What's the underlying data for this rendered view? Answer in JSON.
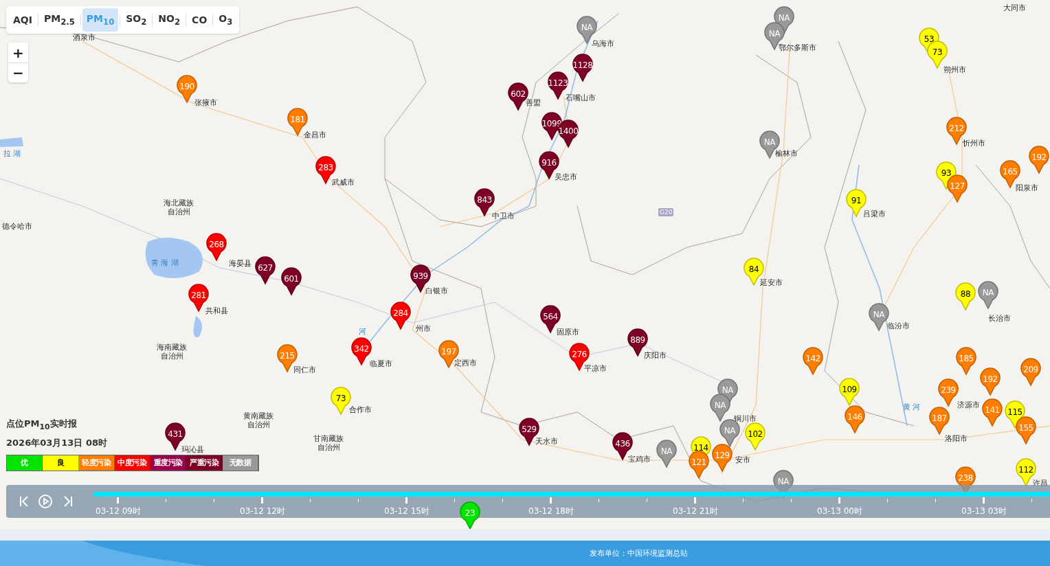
{
  "tabs": [
    {
      "label": "AQI",
      "selected": false
    },
    {
      "label": "PM$_{2.5}$",
      "selected": false
    },
    {
      "label": "PM$_{10}$",
      "selected": true
    },
    {
      "label": "SO$_{2}$",
      "selected": false
    },
    {
      "label": "NO$_{2}$",
      "selected": false
    },
    {
      "label": "CO",
      "selected": false
    },
    {
      "label": "O$_{3}$",
      "selected": false
    }
  ],
  "zoom": {
    "in": "+",
    "out": "−"
  },
  "cities": [
    {
      "name": "大同市",
      "kind": "city"
    },
    {
      "name": "酒泉市",
      "kind": "city"
    },
    {
      "name": "乌海市",
      "kind": "city"
    },
    {
      "name": "鄂尔多斯市",
      "kind": "city"
    },
    {
      "name": "朔州市",
      "kind": "city"
    },
    {
      "name": "张掖市",
      "kind": "city"
    },
    {
      "name": "善盟",
      "kind": "city"
    },
    {
      "name": "石嘴山市",
      "kind": "city"
    },
    {
      "name": "金昌市",
      "kind": "city"
    },
    {
      "name": "忻州市",
      "kind": "city"
    },
    {
      "name": "榆林市",
      "kind": "city"
    },
    {
      "name": "武威市",
      "kind": "city"
    },
    {
      "name": "吴忠市",
      "kind": "city"
    },
    {
      "name": "阳泉市",
      "kind": "city"
    },
    {
      "name": "海北藏族自治州",
      "kind": "prefecture"
    },
    {
      "name": "中卫市",
      "kind": "city"
    },
    {
      "name": "吕梁市",
      "kind": "city"
    },
    {
      "name": "德令哈市",
      "kind": "city"
    },
    {
      "name": "海晏县",
      "kind": "city"
    },
    {
      "name": "延安市",
      "kind": "city"
    },
    {
      "name": "白银市",
      "kind": "city"
    },
    {
      "name": "共和县",
      "kind": "city"
    },
    {
      "name": "州市",
      "kind": "city"
    },
    {
      "name": "固原市",
      "kind": "city"
    },
    {
      "name": "临汾市",
      "kind": "city"
    },
    {
      "name": "长治市",
      "kind": "city"
    },
    {
      "name": "海南藏族自治州",
      "kind": "prefecture"
    },
    {
      "name": "同仁市",
      "kind": "city"
    },
    {
      "name": "临夏市",
      "kind": "city"
    },
    {
      "name": "定西市",
      "kind": "city"
    },
    {
      "name": "平凉市",
      "kind": "city"
    },
    {
      "name": "庆阳市",
      "kind": "city"
    },
    {
      "name": "黄南藏族自治州",
      "kind": "prefecture"
    },
    {
      "name": "合作市",
      "kind": "city"
    },
    {
      "name": "铜川市",
      "kind": "city"
    },
    {
      "name": "济源市",
      "kind": "city"
    },
    {
      "name": "玛沁县",
      "kind": "city"
    },
    {
      "name": "甘南藏族自治州",
      "kind": "prefecture"
    },
    {
      "name": "天水市",
      "kind": "city"
    },
    {
      "name": "宝鸡市",
      "kind": "city"
    },
    {
      "name": "安市",
      "kind": "city"
    },
    {
      "name": "洛阳市",
      "kind": "city"
    },
    {
      "name": "许昌",
      "kind": "city"
    }
  ],
  "water_labels": [
    "拉 湖",
    "青 海 湖",
    "河",
    "黄 河"
  ],
  "road_badge": "G20",
  "markers": [
    {
      "value": "NA",
      "color": "#999999"
    },
    {
      "value": "NA",
      "color": "#999999"
    },
    {
      "value": "NA",
      "color": "#999999"
    },
    {
      "value": "53",
      "color": "#ffff00"
    },
    {
      "value": "73",
      "color": "#ffff00"
    },
    {
      "value": "1128",
      "color": "#7e0023"
    },
    {
      "value": "1123",
      "color": "#7e0023"
    },
    {
      "value": "190",
      "color": "#ff7e00"
    },
    {
      "value": "602",
      "color": "#7e0023"
    },
    {
      "value": "181",
      "color": "#ff7e00"
    },
    {
      "value": "1099",
      "color": "#7e0023"
    },
    {
      "value": "1400",
      "color": "#7e0023"
    },
    {
      "value": "212",
      "color": "#ff7e00"
    },
    {
      "value": "NA",
      "color": "#999999"
    },
    {
      "value": "192",
      "color": "#ff7e00"
    },
    {
      "value": "916",
      "color": "#7e0023"
    },
    {
      "value": "283",
      "color": "#ff0000"
    },
    {
      "value": "93",
      "color": "#ffff00"
    },
    {
      "value": "165",
      "color": "#ff7e00"
    },
    {
      "value": "127",
      "color": "#ff7e00"
    },
    {
      "value": "843",
      "color": "#7e0023"
    },
    {
      "value": "91",
      "color": "#ffff00"
    },
    {
      "value": "268",
      "color": "#ff0000"
    },
    {
      "value": "627",
      "color": "#7e0023"
    },
    {
      "value": "84",
      "color": "#ffff00"
    },
    {
      "value": "601",
      "color": "#7e0023"
    },
    {
      "value": "939",
      "color": "#7e0023"
    },
    {
      "value": "281",
      "color": "#ff0000"
    },
    {
      "value": "88",
      "color": "#ffff00"
    },
    {
      "value": "NA",
      "color": "#999999"
    },
    {
      "value": "284",
      "color": "#ff0000"
    },
    {
      "value": "564",
      "color": "#7e0023"
    },
    {
      "value": "NA",
      "color": "#999999"
    },
    {
      "value": "889",
      "color": "#7e0023"
    },
    {
      "value": "342",
      "color": "#ff0000"
    },
    {
      "value": "197",
      "color": "#ff7e00"
    },
    {
      "value": "215",
      "color": "#ff7e00"
    },
    {
      "value": "276",
      "color": "#ff0000"
    },
    {
      "value": "142",
      "color": "#ff7e00"
    },
    {
      "value": "185",
      "color": "#ff7e00"
    },
    {
      "value": "209",
      "color": "#ff7e00"
    },
    {
      "value": "192",
      "color": "#ff7e00"
    },
    {
      "value": "NA",
      "color": "#999999"
    },
    {
      "value": "109",
      "color": "#ffff00"
    },
    {
      "value": "239",
      "color": "#ff7e00"
    },
    {
      "value": "73",
      "color": "#ffff00"
    },
    {
      "value": "NA",
      "color": "#999999"
    },
    {
      "value": "141",
      "color": "#ff7e00"
    },
    {
      "value": "115",
      "color": "#ffff00"
    },
    {
      "value": "146",
      "color": "#ff7e00"
    },
    {
      "value": "187",
      "color": "#ff7e00"
    },
    {
      "value": "155",
      "color": "#ff7e00"
    },
    {
      "value": "431",
      "color": "#7e0023"
    },
    {
      "value": "529",
      "color": "#7e0023"
    },
    {
      "value": "NA",
      "color": "#999999"
    },
    {
      "value": "102",
      "color": "#ffff00"
    },
    {
      "value": "436",
      "color": "#7e0023"
    },
    {
      "value": "NA",
      "color": "#999999"
    },
    {
      "value": "114",
      "color": "#ffff00"
    },
    {
      "value": "129",
      "color": "#ff7e00"
    },
    {
      "value": "121",
      "color": "#ff7e00"
    },
    {
      "value": "112",
      "color": "#ffff00"
    },
    {
      "value": "238",
      "color": "#ff7e00"
    },
    {
      "value": "NA",
      "color": "#999999"
    },
    {
      "value": "23",
      "color": "#00e400"
    }
  ],
  "report_title": "点位PM$_{10}$实时报",
  "report_time": "2026年03月13日 08时",
  "legend": [
    {
      "label": "优",
      "color": "#00e400"
    },
    {
      "label": "良",
      "color": "#ffff00"
    },
    {
      "label": "轻度污染",
      "color": "#ff7e00"
    },
    {
      "label": "中度污染",
      "color": "#ff0000"
    },
    {
      "label": "重度污染",
      "color": "#99004c"
    },
    {
      "label": "严重污染",
      "color": "#7e0023"
    },
    {
      "label": "无数据",
      "color": "#999999"
    }
  ],
  "timeline": {
    "ticks": [
      "03-12 09时",
      "03-12 12时",
      "03-12 15时",
      "03-12 18时",
      "03-12 21时",
      "03-13 00时",
      "03-13 03时"
    ]
  },
  "footer": {
    "publisher": "发布单位：中国环境监测总站"
  }
}
